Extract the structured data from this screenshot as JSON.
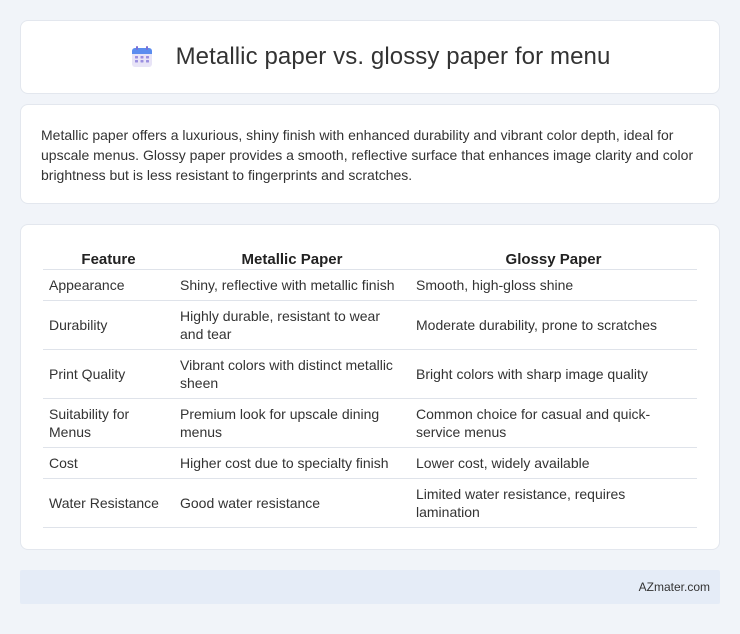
{
  "header": {
    "title": "Metallic paper vs. glossy paper for menu",
    "icon": "calendar-icon"
  },
  "description": "Metallic paper offers a luxurious, shiny finish with enhanced durability and vibrant color depth, ideal for upscale menus. Glossy paper provides a smooth, reflective surface that enhances image clarity and color brightness but is less resistant to fingerprints and scratches.",
  "table": {
    "headers": [
      "Feature",
      "Metallic Paper",
      "Glossy Paper"
    ],
    "rows": [
      [
        "Appearance",
        "Shiny, reflective with metallic finish",
        "Smooth, high-gloss shine"
      ],
      [
        "Durability",
        "Highly durable, resistant to wear and tear",
        "Moderate durability, prone to scratches"
      ],
      [
        "Print Quality",
        "Vibrant colors with distinct metallic sheen",
        "Bright colors with sharp image quality"
      ],
      [
        "Suitability for Menus",
        "Premium look for upscale dining menus",
        "Common choice for casual and quick-service menus"
      ],
      [
        "Cost",
        "Higher cost due to specialty finish",
        "Lower cost, widely available"
      ],
      [
        "Water Resistance",
        "Good water resistance",
        "Limited water resistance, requires lamination"
      ]
    ]
  },
  "footer": {
    "brand": "AZmater.com"
  }
}
